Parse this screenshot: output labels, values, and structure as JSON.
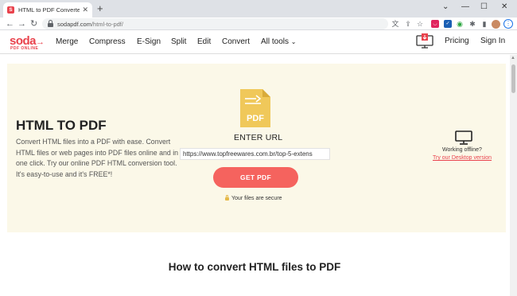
{
  "browser": {
    "tab_title": "HTML to PDF Converter - Conve",
    "tab_favicon": "S",
    "new_tab_label": "+",
    "url_domain": "sodapdf.com",
    "url_path": "/html-to-pdf/",
    "window_controls": [
      "chevron-down-icon",
      "minimize-icon",
      "maximize-icon",
      "close-icon"
    ]
  },
  "site": {
    "logo_text": "soda",
    "logo_subtext": "PDF ONLINE",
    "nav": [
      "Merge",
      "Compress",
      "E-Sign",
      "Split",
      "Edit",
      "Convert",
      "All tools"
    ],
    "pricing": "Pricing",
    "signin": "Sign In",
    "brand_color": "#e9424c"
  },
  "hero": {
    "title": "HTML TO PDF",
    "description": "Convert HTML files into a PDF with ease. Convert HTML files or web pages into PDF files online and in one click. Try our online PDF HTML conversion tool. It's easy-to-use and it's FREE*!",
    "pdf_icon_label": "PDF",
    "enter_url_label": "ENTER URL",
    "url_value": "https://www.topfreewares.com.br/top-5-extens",
    "button_label": "GET PDF",
    "secure_text": "Your files are secure",
    "offline_text": "Working offline?",
    "desktop_link": "Try our Desktop version",
    "background": "#fbf8e8",
    "button_color": "#f5635e"
  },
  "section": {
    "heading": "How to convert HTML files to PDF"
  }
}
